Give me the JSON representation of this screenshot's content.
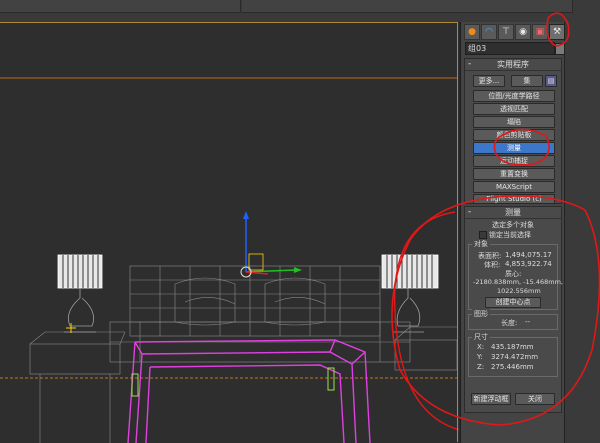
{
  "command_panel": {
    "tabs": [
      {
        "icon": "create-sphere-icon"
      },
      {
        "icon": "modify-bend-icon"
      },
      {
        "icon": "hierarchy-icon"
      },
      {
        "icon": "motion-icon"
      },
      {
        "icon": "display-icon"
      },
      {
        "icon": "utilities-hammer-icon"
      }
    ],
    "object_name": "组03",
    "utilities": {
      "title": "实用程序",
      "more_label": "更多...",
      "sets_label": "集",
      "buttons": [
        "位图/光度学路径",
        "透视匹配",
        "塌陷",
        "颜色剪贴板",
        "测量",
        "运动捕捉",
        "重置变换",
        "MAXScript",
        "Flight Studio (c)"
      ],
      "selected": "测量"
    },
    "measure": {
      "title": "测量",
      "selection_info": "选定多个对象",
      "lock_label": "锁定当前选择",
      "objects": {
        "title": "对象",
        "surface_area_label": "表面积:",
        "surface_area_value": "1,494,075.17",
        "volume_label": "体积:",
        "volume_value": "4,853,922.74",
        "center_label": "质心:",
        "center_value": "-2180.838mm, -15.468mm,",
        "center_value_2": "1022.556mm",
        "create_center_label": "创建中心点"
      },
      "shapes": {
        "title": "图形",
        "length_label": "长度:",
        "length_value": "--"
      },
      "dimensions": {
        "title": "尺寸",
        "x_label": "X:",
        "x_value": "435.187mm",
        "y_label": "Y:",
        "y_value": "3274.472mm",
        "z_label": "Z:",
        "z_value": "275.446mm"
      },
      "new_float_label": "新建浮动框",
      "close_label": "关闭"
    }
  },
  "colors": {
    "selected_button": "#3d77c9",
    "annotation_red": "#e01818",
    "wire_pink": "#e040e0",
    "wire_gray": "#8a8a8a",
    "viewport_bg": "#2e2e2e"
  }
}
